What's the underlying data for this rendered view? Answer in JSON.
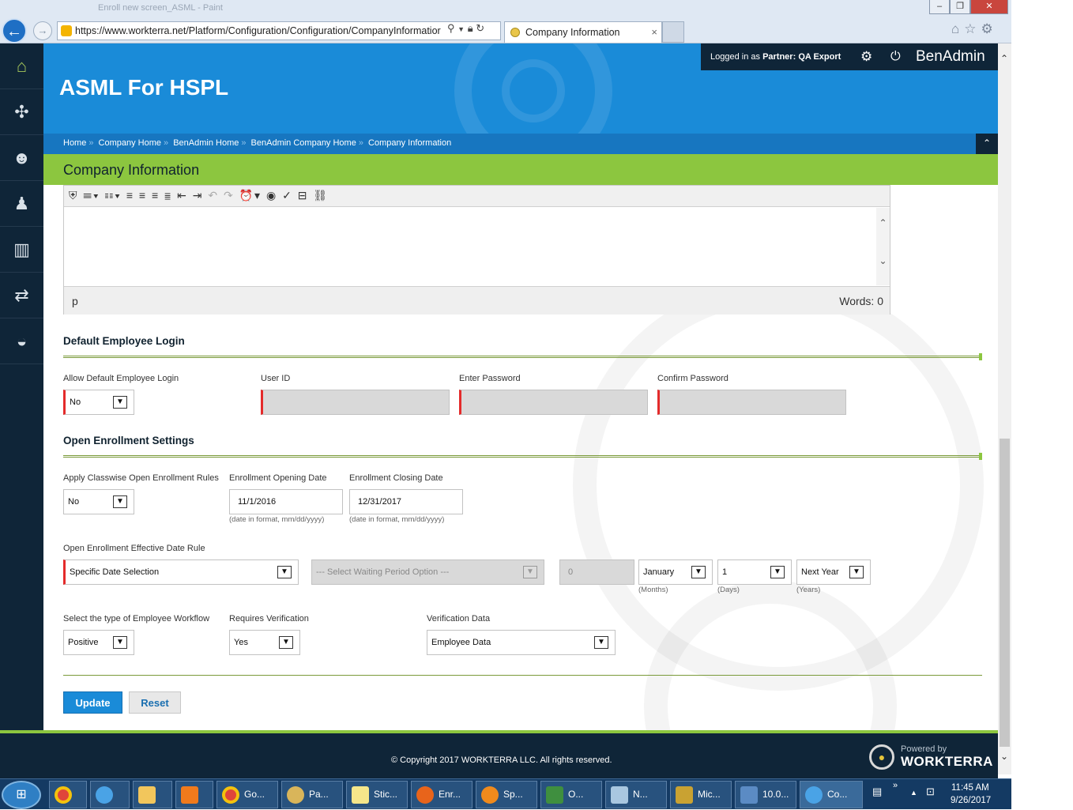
{
  "browser": {
    "window_title": "Enroll new screen_ASML - Paint",
    "url": "https://www.workterra.net/Platform/Configuration/Configuration/CompanyInformatior",
    "tab_title": "Company Information",
    "tab_close": "×"
  },
  "header": {
    "app_title": "ASML For HSPL",
    "logged_in_prefix": "Logged in as",
    "partner_label": "Partner:",
    "partner_name": "QA Export",
    "module": "BenAdmin"
  },
  "breadcrumb": [
    "Home",
    "Company Home",
    "BenAdmin Home",
    "BenAdmin Company Home",
    "Company Information"
  ],
  "page_title": "Company Information",
  "editor": {
    "status_tag": "p",
    "words_label": "Words: 0"
  },
  "default_login": {
    "heading": "Default Employee Login",
    "allow_label": "Allow Default Employee Login",
    "allow_value": "No",
    "user_id_label": "User ID",
    "password_label": "Enter Password",
    "confirm_label": "Confirm Password"
  },
  "open_enrollment": {
    "heading": "Open Enrollment Settings",
    "classwise_label": "Apply Classwise Open Enrollment Rules",
    "classwise_value": "No",
    "opening_label": "Enrollment Opening Date",
    "opening_value": "11/1/2016",
    "closing_label": "Enrollment Closing Date",
    "closing_value": "12/31/2017",
    "date_hint": "(date in format, mm/dd/yyyy)",
    "rule_label": "Open Enrollment Effective Date Rule",
    "rule_value": "Specific Date Selection",
    "waiting_placeholder": "--- Select Waiting Period Option ---",
    "waiting_days": "0",
    "month_value": "January",
    "month_hint": "(Months)",
    "day_value": "1",
    "day_hint": "(Days)",
    "year_value": "Next Year",
    "year_hint": "(Years)",
    "workflow_label": "Select the type of Employee Workflow",
    "workflow_value": "Positive",
    "verification_label": "Requires Verification",
    "verification_value": "Yes",
    "verification_data_label": "Verification Data",
    "verification_data_value": "Employee Data"
  },
  "buttons": {
    "update": "Update",
    "reset": "Reset"
  },
  "footer": {
    "copyright": "© Copyright 2017 WORKTERRA LLC. All rights reserved.",
    "powered_by": "Powered by",
    "brand": "WORKTERRA"
  },
  "taskbar": {
    "items": [
      "Go...",
      "Pa...",
      "Stic...",
      "Enr...",
      "Sp...",
      "O...",
      "N...",
      "Mic...",
      "10.0...",
      "Co..."
    ],
    "time": "11:45 AM",
    "date": "9/26/2017"
  },
  "colors": {
    "brand_blue": "#1a8bd8",
    "brand_green": "#8cc63f",
    "navy": "#0f2538",
    "required": "#e42b2b"
  }
}
